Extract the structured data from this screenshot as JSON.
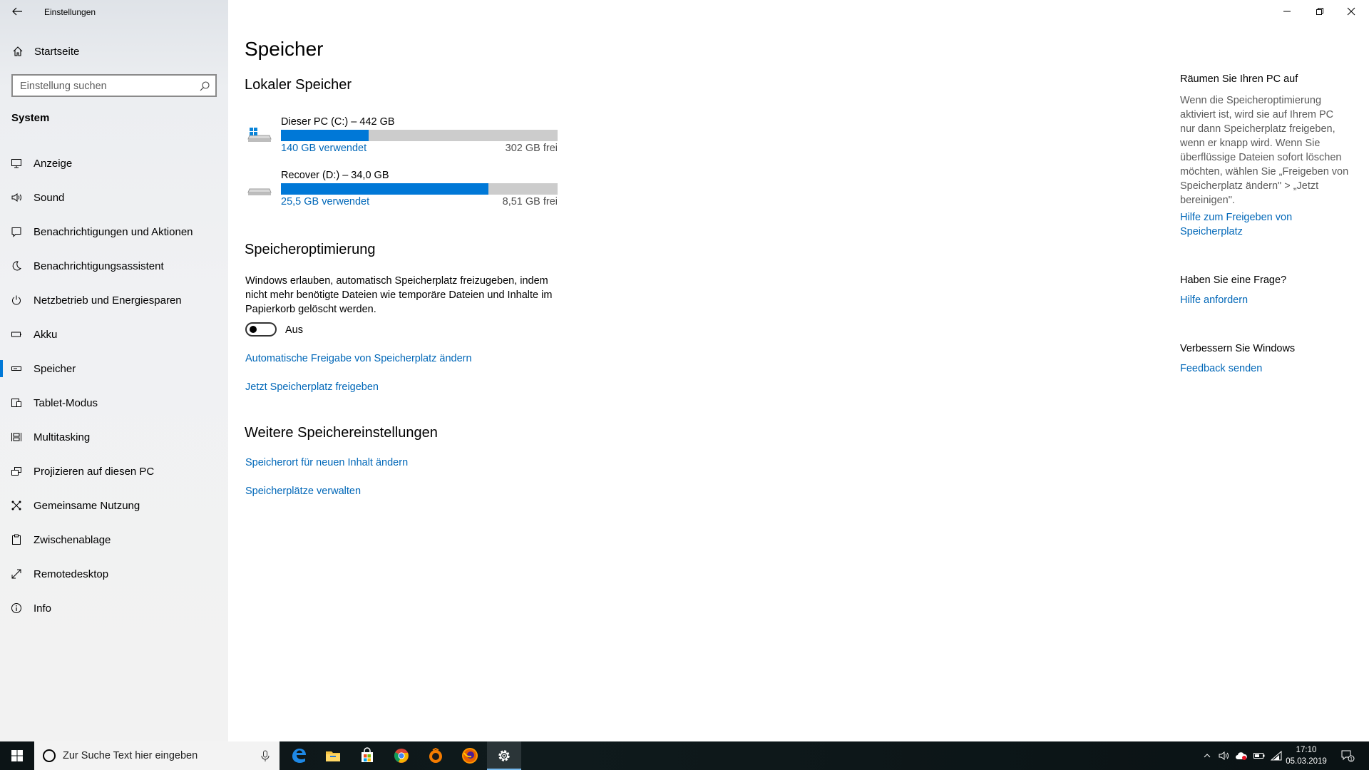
{
  "window": {
    "title": "Einstellungen",
    "controls": [
      "minimize-icon",
      "restore-icon",
      "close-icon"
    ]
  },
  "sidebar": {
    "home_label": "Startseite",
    "search_placeholder": "Einstellung suchen",
    "section_title": "System",
    "items": [
      {
        "label": "Anzeige",
        "icon": "display-icon"
      },
      {
        "label": "Sound",
        "icon": "speaker-icon"
      },
      {
        "label": "Benachrichtigungen und Aktionen",
        "icon": "notification-icon"
      },
      {
        "label": "Benachrichtigungsassistent",
        "icon": "moon-icon"
      },
      {
        "label": "Netzbetrieb und Energiesparen",
        "icon": "power-icon"
      },
      {
        "label": "Akku",
        "icon": "battery-icon"
      },
      {
        "label": "Speicher",
        "icon": "storage-icon",
        "active": true
      },
      {
        "label": "Tablet-Modus",
        "icon": "tablet-icon"
      },
      {
        "label": "Multitasking",
        "icon": "multitasking-icon"
      },
      {
        "label": "Projizieren auf diesen PC",
        "icon": "project-icon"
      },
      {
        "label": "Gemeinsame Nutzung",
        "icon": "share-icon"
      },
      {
        "label": "Zwischenablage",
        "icon": "clipboard-icon"
      },
      {
        "label": "Remotedesktop",
        "icon": "remote-icon"
      },
      {
        "label": "Info",
        "icon": "info-icon"
      }
    ]
  },
  "main": {
    "page_title": "Speicher",
    "local_storage_heading": "Lokaler Speicher",
    "drives": [
      {
        "name": "Dieser PC (C:) – 442 GB",
        "used": "140 GB verwendet",
        "free": "302 GB frei",
        "used_fraction": 0.317,
        "icon": "system-drive-icon"
      },
      {
        "name": "Recover (D:) – 34,0 GB",
        "used": "25,5 GB verwendet",
        "free": "8,51 GB frei",
        "used_fraction": 0.75,
        "icon": "drive-icon"
      }
    ],
    "optimization_heading": "Speicheroptimierung",
    "optimization_description": "Windows erlauben, automatisch Speicherplatz freizugeben, indem nicht mehr benötigte Dateien wie temporäre Dateien und Inhalte im Papierkorb gelöscht werden.",
    "toggle_state": "Aus",
    "link_auto": "Automatische Freigabe von Speicherplatz ändern",
    "link_free_now": "Jetzt Speicherplatz freigeben",
    "more_heading": "Weitere Speichereinstellungen",
    "link_location": "Speicherort für neuen Inhalt ändern",
    "link_spaces": "Speicherplätze verwalten"
  },
  "aside": {
    "cleanup_heading": "Räumen Sie Ihren PC auf",
    "cleanup_text": "Wenn die Speicheroptimierung aktiviert ist, wird sie auf Ihrem PC nur dann Speicherplatz freigeben, wenn er knapp wird. Wenn Sie überflüssige Dateien sofort löschen möchten, wählen Sie „Freigeben von Speicherplatz ändern\" > „Jetzt bereinigen\".",
    "cleanup_link": "Hilfe zum Freigeben von Speicherplatz",
    "question_heading": "Haben Sie eine Frage?",
    "question_link": "Hilfe anfordern",
    "improve_heading": "Verbessern Sie Windows",
    "improve_link": "Feedback senden"
  },
  "taskbar": {
    "search_placeholder": "Zur Suche Text hier eingeben",
    "apps": [
      "edge-icon",
      "file-explorer-icon",
      "store-icon",
      "chrome-icon",
      "media-player-icon",
      "firefox-icon",
      "settings-icon"
    ],
    "time": "17:10",
    "date": "05.03.2019",
    "notification_count": "1"
  },
  "colors": {
    "accent": "#0078d7",
    "link": "#0067b8",
    "bar_bg": "#cccccc"
  }
}
